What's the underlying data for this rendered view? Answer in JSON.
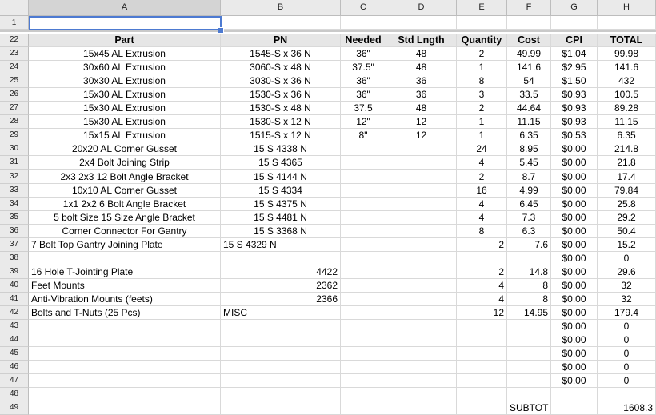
{
  "columns": [
    "A",
    "B",
    "C",
    "D",
    "E",
    "F",
    "G",
    "H"
  ],
  "first_row": "1",
  "header_row": {
    "num": "22",
    "cells": [
      "Part",
      "PN",
      "Needed",
      "Std Lngth",
      "Quantity",
      "Cost",
      "CPI",
      "TOTAL"
    ]
  },
  "rows": [
    {
      "num": "23",
      "cells": [
        "15x45 AL Extrusion",
        "1545-S x 36 N",
        "36\"",
        "48",
        "2",
        "49.99",
        "$1.04",
        "99.98"
      ]
    },
    {
      "num": "24",
      "cells": [
        "30x60 AL Extrusion",
        "3060-S x 48 N",
        "37.5\"",
        "48",
        "1",
        "141.6",
        "$2.95",
        "141.6"
      ]
    },
    {
      "num": "25",
      "cells": [
        "30x30 AL Extrusion",
        "3030-S x 36 N",
        "36\"",
        "36",
        "8",
        "54",
        "$1.50",
        "432"
      ]
    },
    {
      "num": "26",
      "cells": [
        "15x30 AL Extrusion",
        "1530-S x 36 N",
        "36\"",
        "36",
        "3",
        "33.5",
        "$0.93",
        "100.5"
      ]
    },
    {
      "num": "27",
      "cells": [
        "15x30 AL Extrusion",
        "1530-S x 48 N",
        "37.5",
        "48",
        "2",
        "44.64",
        "$0.93",
        "89.28"
      ]
    },
    {
      "num": "28",
      "cells": [
        "15x30 AL Extrusion",
        "1530-S x 12 N",
        "12\"",
        "12",
        "1",
        "11.15",
        "$0.93",
        "11.15"
      ]
    },
    {
      "num": "29",
      "cells": [
        "15x15 AL Extrusion",
        "1515-S x 12 N",
        "8\"",
        "12",
        "1",
        "6.35",
        "$0.53",
        "6.35"
      ]
    },
    {
      "num": "30",
      "cells": [
        "20x20 AL Corner Gusset",
        "15 S 4338 N",
        "",
        "",
        "24",
        "8.95",
        "$0.00",
        "214.8"
      ]
    },
    {
      "num": "31",
      "cells": [
        "2x4 Bolt Joining Strip",
        "15 S 4365",
        "",
        "",
        "4",
        "5.45",
        "$0.00",
        "21.8"
      ]
    },
    {
      "num": "32",
      "cells": [
        "2x3 2x3 12 Bolt Angle Bracket",
        "15 S 4144 N",
        "",
        "",
        "2",
        "8.7",
        "$0.00",
        "17.4"
      ]
    },
    {
      "num": "33",
      "cells": [
        "10x10 AL Corner Gusset",
        "15 S 4334",
        "",
        "",
        "16",
        "4.99",
        "$0.00",
        "79.84"
      ]
    },
    {
      "num": "34",
      "cells": [
        "1x1 2x2 6 Bolt Angle Bracket",
        "15 S 4375 N",
        "",
        "",
        "4",
        "6.45",
        "$0.00",
        "25.8"
      ]
    },
    {
      "num": "35",
      "cells": [
        "5 bolt Size 15 Size Angle Bracket",
        "15 S 4481 N",
        "",
        "",
        "4",
        "7.3",
        "$0.00",
        "29.2"
      ]
    },
    {
      "num": "36",
      "cells": [
        "Corner Connector For Gantry",
        "15 S 3368 N",
        "",
        "",
        "8",
        "6.3",
        "$0.00",
        "50.4"
      ]
    },
    {
      "num": "37",
      "cells": [
        "7 Bolt Top Gantry Joining Plate",
        "15 S 4329 N",
        "",
        "",
        "2",
        "7.6",
        "$0.00",
        "15.2"
      ]
    },
    {
      "num": "38",
      "cells": [
        "",
        "",
        "",
        "",
        "",
        "",
        "$0.00",
        "0"
      ]
    },
    {
      "num": "39",
      "cells": [
        "16 Hole T-Jointing Plate",
        "4422",
        "",
        "",
        "2",
        "14.8",
        "$0.00",
        "29.6"
      ]
    },
    {
      "num": "40",
      "cells": [
        "Feet Mounts",
        "2362",
        "",
        "",
        "4",
        "8",
        "$0.00",
        "32"
      ]
    },
    {
      "num": "41",
      "cells": [
        "Anti-Vibration Mounts (feets)",
        "2366",
        "",
        "",
        "4",
        "8",
        "$0.00",
        "32"
      ]
    },
    {
      "num": "42",
      "cells": [
        "Bolts and T-Nuts (25 Pcs)",
        "MISC",
        "",
        "",
        "12",
        "14.95",
        "$0.00",
        "179.4"
      ]
    },
    {
      "num": "43",
      "cells": [
        "",
        "",
        "",
        "",
        "",
        "",
        "$0.00",
        "0"
      ]
    },
    {
      "num": "44",
      "cells": [
        "",
        "",
        "",
        "",
        "",
        "",
        "$0.00",
        "0"
      ]
    },
    {
      "num": "45",
      "cells": [
        "",
        "",
        "",
        "",
        "",
        "",
        "$0.00",
        "0"
      ]
    },
    {
      "num": "46",
      "cells": [
        "",
        "",
        "",
        "",
        "",
        "",
        "$0.00",
        "0"
      ]
    },
    {
      "num": "47",
      "cells": [
        "",
        "",
        "",
        "",
        "",
        "",
        "$0.00",
        "0"
      ]
    },
    {
      "num": "48",
      "cells": [
        "",
        "",
        "",
        "",
        "",
        "",
        "",
        ""
      ]
    },
    {
      "num": "49",
      "cells": [
        "",
        "",
        "",
        "",
        "",
        "SUBTOT",
        "",
        "1608.3"
      ]
    }
  ]
}
